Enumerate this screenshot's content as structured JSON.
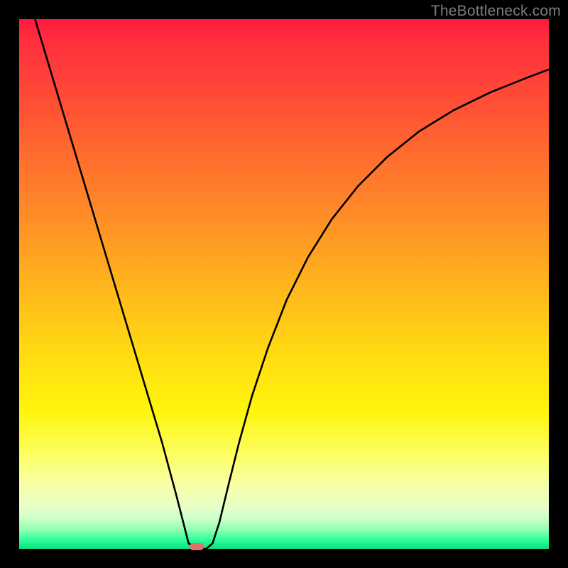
{
  "watermark": "TheBottleneck.com",
  "colors": {
    "curve": "#000000",
    "marker": "#e2716a",
    "background": "#000000"
  },
  "chart_data": {
    "type": "line",
    "title": "",
    "xlabel": "",
    "ylabel": "",
    "xlim": [
      0,
      1
    ],
    "ylim": [
      0,
      1
    ],
    "series": [
      {
        "name": "bottleneck-curve",
        "x": [
          0.03,
          0.06,
          0.09,
          0.12,
          0.15,
          0.18,
          0.21,
          0.24,
          0.27,
          0.297,
          0.32,
          0.34,
          0.353,
          0.365,
          0.378,
          0.395,
          0.415,
          0.44,
          0.47,
          0.505,
          0.545,
          0.59,
          0.64,
          0.695,
          0.755,
          0.82,
          0.89,
          0.96,
          1.0
        ],
        "values": [
          1.0,
          0.9,
          0.8,
          0.7,
          0.6,
          0.5,
          0.4,
          0.3,
          0.2,
          0.1,
          0.01,
          0.0,
          0.0,
          0.01,
          0.05,
          0.12,
          0.2,
          0.29,
          0.38,
          0.47,
          0.55,
          0.622,
          0.685,
          0.74,
          0.788,
          0.828,
          0.862,
          0.89,
          0.905
        ]
      }
    ],
    "marker": {
      "x": 0.335,
      "y": 0.003,
      "label": "optimal-point"
    }
  }
}
